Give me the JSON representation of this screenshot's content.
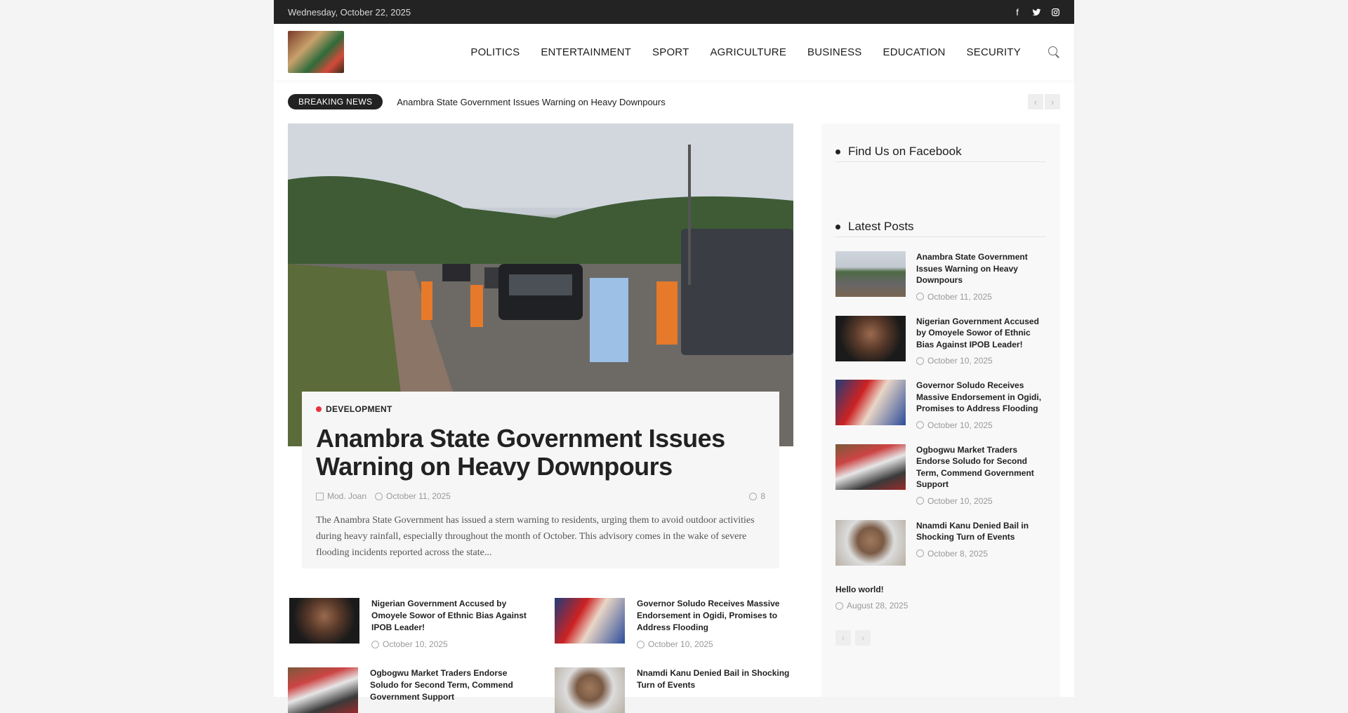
{
  "topbar": {
    "date": "Wednesday, October 22, 2025",
    "social": [
      "facebook-icon",
      "twitter-icon",
      "instagram-icon"
    ]
  },
  "nav": {
    "items": [
      "POLITICS",
      "ENTERTAINMENT",
      "SPORT",
      "AGRICULTURE",
      "BUSINESS",
      "EDUCATION",
      "SECURITY"
    ]
  },
  "breaking": {
    "label": "BREAKING NEWS",
    "headline": "Anambra State Government Issues Warning on Heavy Downpours",
    "prev": "‹",
    "next": "›"
  },
  "hero": {
    "category": "DEVELOPMENT",
    "title": "Anambra State Government Issues Warning on Heavy Downpours",
    "author": "Mod. Joan",
    "date": "October 11, 2025",
    "likes": "8",
    "excerpt": "The Anambra State Government has issued a stern warning to residents, urging them to avoid outdoor activities during heavy rainfall, especially throughout the month of October. This advisory comes in the wake of severe flooding incidents reported across the state..."
  },
  "grid_posts": [
    {
      "title": "Nigerian Government Accused by Omoyele Sowor of Ethnic Bias Against IPOB Leader!",
      "date": "October 10, 2025"
    },
    {
      "title": "Governor Soludo Receives Massive Endorsement in Ogidi, Promises to Address Flooding",
      "date": "October 10, 2025"
    },
    {
      "title": "Ogbogwu Market Traders Endorse Soludo for Second Term, Commend Government Support",
      "date": ""
    },
    {
      "title": "Nnamdi Kanu Denied Bail in Shocking Turn of Events",
      "date": ""
    }
  ],
  "sidebar": {
    "facebook_title": "Find Us on Facebook",
    "latest_title": "Latest Posts",
    "latest": [
      {
        "title": "Anambra State Government Issues Warning on Heavy Downpours",
        "date": "October 11, 2025"
      },
      {
        "title": "Nigerian Government Accused by Omoyele Sowor of Ethnic Bias Against IPOB Leader!",
        "date": "October 10, 2025"
      },
      {
        "title": "Governor Soludo Receives Massive Endorsement in Ogidi, Promises to Address Flooding",
        "date": "October 10, 2025"
      },
      {
        "title": "Ogbogwu Market Traders Endorse Soludo for Second Term, Commend Government Support",
        "date": "October 10, 2025"
      },
      {
        "title": "Nnamdi Kanu Denied Bail in Shocking Turn of Events",
        "date": "October 8, 2025"
      },
      {
        "title": "Hello world!",
        "date": "August 28, 2025"
      }
    ],
    "prev": "‹",
    "next": "›"
  }
}
